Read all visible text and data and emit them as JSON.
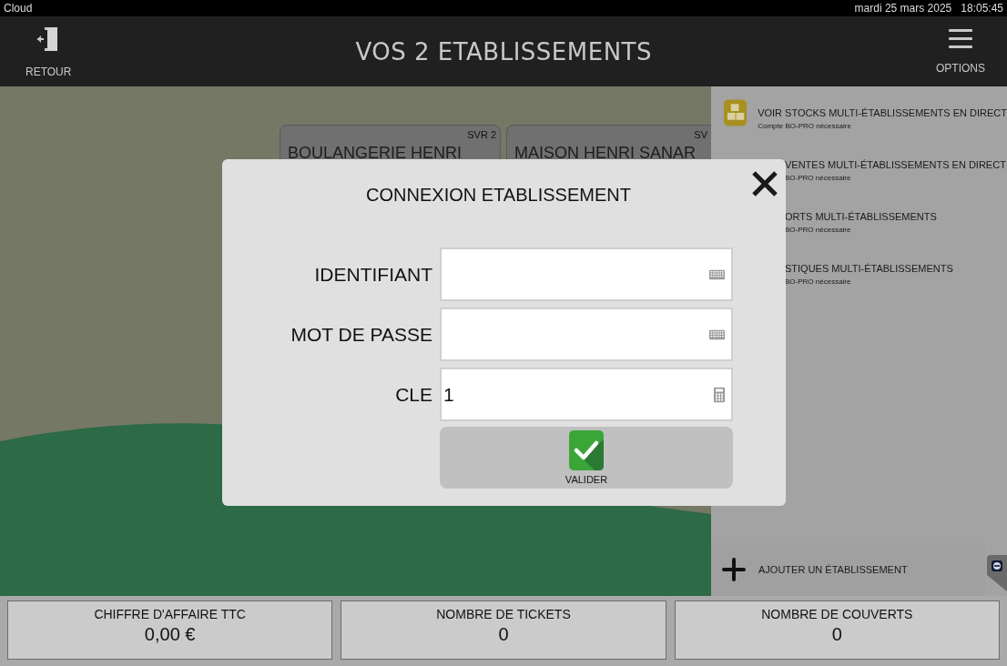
{
  "status_bar": {
    "app": "Cloud",
    "date": "mardi 25 mars 2025",
    "time": "18:05:45"
  },
  "header": {
    "back": "RETOUR",
    "title": "VOS 2 ETABLISSEMENTS",
    "options": "OPTIONS"
  },
  "cards": [
    {
      "badge": "SVR 2",
      "name": "BOULANGERIE HENRI"
    },
    {
      "badge": "SV",
      "name": "MAISON HENRI SANAR"
    }
  ],
  "side_menu": [
    {
      "title": "VOIR STOCKS MULTI-ÉTABLISSEMENTS EN DIRECT",
      "note": "Compte BO-PRO nécessaire",
      "icon_visible": true
    },
    {
      "title": "VENTES MULTI-ÉTABLISSEMENTS EN DIRECT",
      "note": "BO-PRO nécessaire",
      "icon_visible": false
    },
    {
      "title": "ORTS MULTI-ÉTABLISSEMENTS",
      "note": "BO-PRO nécessaire",
      "icon_visible": false
    },
    {
      "title": "STIQUES MULTI-ÉTABLISSEMENTS",
      "note": "BO-PRO nécessaire",
      "icon_visible": false
    }
  ],
  "add_button": "AJOUTER UN ÉTABLISSEMENT",
  "stats": [
    {
      "label": "CHIFFRE D'AFFAIRE TTC",
      "value": "0,00 €"
    },
    {
      "label": "NOMBRE DE TICKETS",
      "value": "0"
    },
    {
      "label": "NOMBRE DE COUVERTS",
      "value": "0"
    }
  ],
  "dialog": {
    "title": "CONNEXION ETABLISSEMENT",
    "fields": [
      {
        "label": "IDENTIFIANT",
        "kind": "keyboard"
      },
      {
        "label": "MOT DE PASSE",
        "kind": "keyboard"
      },
      {
        "label": "CLE",
        "value": "1",
        "kind": "calculator"
      }
    ],
    "submit": "VALIDER"
  }
}
